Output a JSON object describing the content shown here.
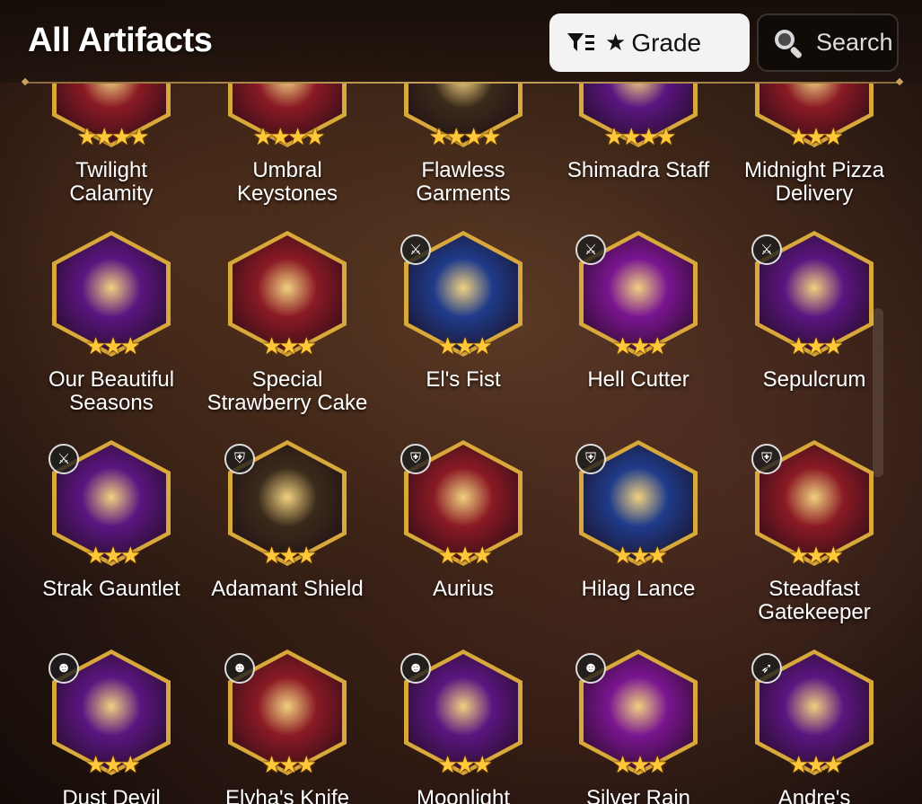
{
  "header": {
    "title": "All Artifacts",
    "grade_label": "Grade",
    "search_label": "Search"
  },
  "colors": {
    "gold": "#d9a83b",
    "star": "#ffc83a",
    "red_bg": "#8a1a24",
    "purple_bg": "#5a1680",
    "blue_bg": "#1f3b8a",
    "grade_button_bg": "#f3f3f3"
  },
  "artifacts": [
    {
      "name_l1": "Twilight",
      "name_l2": "Calamity",
      "stars": "★★★★",
      "bg": "#8a1a24",
      "badge": ""
    },
    {
      "name_l1": "Umbral",
      "name_l2": "Keystones",
      "stars": "★★★★",
      "bg": "#8a1a24",
      "badge": ""
    },
    {
      "name_l1": "Flawless",
      "name_l2": "Garments",
      "stars": "★★★★",
      "bg": "#3a2a1a",
      "badge": ""
    },
    {
      "name_l1": "Shimadra Staff",
      "name_l2": "",
      "stars": "★★★★",
      "bg": "#5a1680",
      "badge": ""
    },
    {
      "name_l1": "Midnight Pizza",
      "name_l2": "Delivery",
      "stars": "★★★",
      "bg": "#8a1a24",
      "badge": ""
    },
    {
      "name_l1": "Our Beautiful",
      "name_l2": "Seasons",
      "stars": "★★★",
      "bg": "#5a1680",
      "badge": ""
    },
    {
      "name_l1": "Special",
      "name_l2": "Strawberry Cake",
      "stars": "★★★",
      "bg": "#8a1a24",
      "badge": ""
    },
    {
      "name_l1": "El's Fist",
      "name_l2": "",
      "stars": "★★★",
      "bg": "#1f3b8a",
      "badge": "⚔"
    },
    {
      "name_l1": "Hell Cutter",
      "name_l2": "",
      "stars": "★★★",
      "bg": "#7a1590",
      "badge": "⚔"
    },
    {
      "name_l1": "Sepulcrum",
      "name_l2": "",
      "stars": "★★★",
      "bg": "#5a1680",
      "badge": "⚔"
    },
    {
      "name_l1": "Strak Gauntlet",
      "name_l2": "",
      "stars": "★★★",
      "bg": "#5a1680",
      "badge": "⚔"
    },
    {
      "name_l1": "Adamant Shield",
      "name_l2": "",
      "stars": "★★★",
      "bg": "#3a2a1a",
      "badge": "⛨"
    },
    {
      "name_l1": "Aurius",
      "name_l2": "",
      "stars": "★★★",
      "bg": "#8a1a24",
      "badge": "⛨"
    },
    {
      "name_l1": "Hilag Lance",
      "name_l2": "",
      "stars": "★★★",
      "bg": "#1f3b8a",
      "badge": "⛨"
    },
    {
      "name_l1": "Steadfast",
      "name_l2": "Gatekeeper",
      "stars": "★★★",
      "bg": "#8a1a24",
      "badge": "⛨"
    },
    {
      "name_l1": "Dust Devil",
      "name_l2": "",
      "stars": "★★★",
      "bg": "#5a1680",
      "badge": "☻"
    },
    {
      "name_l1": "Elyha's Knife",
      "name_l2": "",
      "stars": "★★★",
      "bg": "#8a1a24",
      "badge": "☻"
    },
    {
      "name_l1": "Moonlight",
      "name_l2": "",
      "stars": "★★★",
      "bg": "#5a1680",
      "badge": "☻"
    },
    {
      "name_l1": "Silver Rain",
      "name_l2": "",
      "stars": "★★★",
      "bg": "#7a1590",
      "badge": "☻"
    },
    {
      "name_l1": "Andre's",
      "name_l2": "",
      "stars": "★★★",
      "bg": "#5a1680",
      "badge": "➶"
    }
  ]
}
